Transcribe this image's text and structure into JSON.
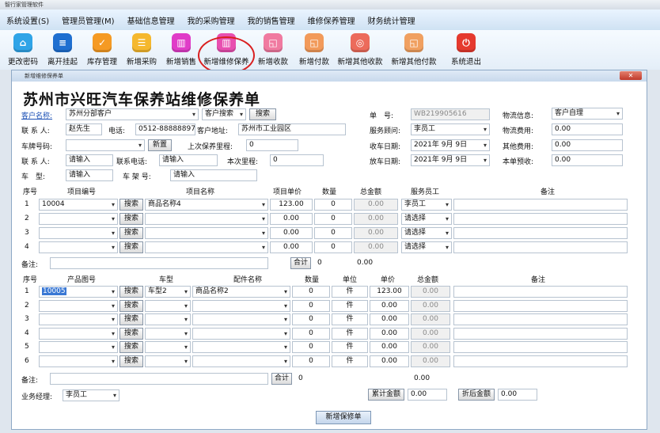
{
  "app": {
    "title": "智行家管理软件"
  },
  "menu": [
    "系统设置(S)",
    "管理员管理(M)",
    "基础信息管理",
    "我的采购管理",
    "我的销售管理",
    "维修保养管理",
    "财务统计管理"
  ],
  "toolbar": [
    {
      "label": "更改密码",
      "icon": "password-icon",
      "color": "#2fa4e7"
    },
    {
      "label": "离开挂起",
      "icon": "suspend-icon",
      "color": "#1f6fd0"
    },
    {
      "label": "库存管理",
      "icon": "inventory-icon",
      "color": "#f59a23"
    },
    {
      "label": "新增采购",
      "icon": "purchase-icon",
      "color": "#f5b82e"
    },
    {
      "label": "新增销售",
      "icon": "sales-chart-icon",
      "color": "#e03cc8"
    },
    {
      "label": "新增维修保养",
      "icon": "repair-chart-icon",
      "color": "#e84fb0"
    },
    {
      "label": "新增收款",
      "icon": "receive-icon",
      "color": "#f07aa0"
    },
    {
      "label": "新增付款",
      "icon": "payment-icon",
      "color": "#f29a5a"
    },
    {
      "label": "新增其他收款",
      "icon": "other-receive-icon",
      "color": "#ec6b5b"
    },
    {
      "label": "新增其他付款",
      "icon": "other-payment-icon",
      "color": "#f0a060"
    },
    {
      "label": "系统退出",
      "icon": "power-icon",
      "color": "#e53a2e"
    }
  ],
  "dialog": {
    "title": "新增维修保养单",
    "close": "✕",
    "heading": "苏州市兴旺汽车保养站维修保养单"
  },
  "header": {
    "customer_label": "客户名称:",
    "customer_value": "苏州分部客户",
    "search_mode": "客户搜索",
    "search_btn": "搜索",
    "order_label": "单　号:",
    "order_value": "WB219905616",
    "logistics_label": "物流信息:",
    "logistics_value": "客户自理",
    "contact_label": "联 系 人:",
    "contact_value": "赵先生",
    "phone_label": "电话:",
    "phone_value": "0512-88888897",
    "address_label": "客户地址:",
    "address_value": "苏州市工业园区",
    "advisor_label": "服务顾问:",
    "advisor_value": "李员工",
    "logistics_fee_label": "物流费用:",
    "logistics_fee_value": "0.00",
    "plate_label": "车牌号码:",
    "plate_value": "",
    "new_btn": "新置",
    "last_mileage_label": "上次保养里程:",
    "last_mileage_value": "0",
    "receive_date_label": "收车日期:",
    "receive_date_value": "2021年 9月 9日",
    "other_fee_label": "其他费用:",
    "other_fee_value": "0.00",
    "contact2_label": "联 系 人:",
    "contact2_value": "请输入",
    "contact_phone_label": "联系电话:",
    "contact_phone_value": "请输入",
    "mileage_label": "本次里程:",
    "mileage_value": "0",
    "release_date_label": "放车日期:",
    "release_date_value": "2021年 9月 9日",
    "prepay_label": "本单预收:",
    "prepay_value": "0.00",
    "car_type_label": "车　型:",
    "car_type_value": "请输入",
    "vin_label": "车 架 号:",
    "vin_value": "请输入"
  },
  "service_table": {
    "headers": [
      "序号",
      "项目编号",
      "项目名称",
      "项目单价",
      "数量",
      "总金额",
      "服务员工",
      "备注"
    ],
    "search_btn": "搜索",
    "rows": [
      {
        "no": "1",
        "code": "10004",
        "name": "商品名称4",
        "price": "123.00",
        "qty": "0",
        "total": "0.00",
        "staff": "李员工"
      },
      {
        "no": "2",
        "code": "",
        "name": "",
        "price": "0.00",
        "qty": "0",
        "total": "0.00",
        "staff": "请选择"
      },
      {
        "no": "3",
        "code": "",
        "name": "",
        "price": "0.00",
        "qty": "0",
        "total": "0.00",
        "staff": "请选择"
      },
      {
        "no": "4",
        "code": "",
        "name": "",
        "price": "0.00",
        "qty": "0",
        "total": "0.00",
        "staff": "请选择"
      }
    ],
    "remark_label": "备注:",
    "sum_btn": "合计",
    "sum_qty": "0",
    "sum_total": "0.00"
  },
  "parts_table": {
    "headers": [
      "序号",
      "产品图号",
      "车型",
      "配件名称",
      "数量",
      "单位",
      "单价",
      "总金额",
      "备注"
    ],
    "search_btn": "搜索",
    "rows": [
      {
        "no": "1",
        "code": "10005",
        "car": "车型2",
        "name": "商品名称2",
        "qty": "0",
        "unit": "件",
        "price": "123.00",
        "total": "0.00"
      },
      {
        "no": "2",
        "code": "",
        "car": "",
        "name": "",
        "qty": "0",
        "unit": "件",
        "price": "0.00",
        "total": "0.00"
      },
      {
        "no": "3",
        "code": "",
        "car": "",
        "name": "",
        "qty": "0",
        "unit": "件",
        "price": "0.00",
        "total": "0.00"
      },
      {
        "no": "4",
        "code": "",
        "car": "",
        "name": "",
        "qty": "0",
        "unit": "件",
        "price": "0.00",
        "total": "0.00"
      },
      {
        "no": "5",
        "code": "",
        "car": "",
        "name": "",
        "qty": "0",
        "unit": "件",
        "price": "0.00",
        "total": "0.00"
      },
      {
        "no": "6",
        "code": "",
        "car": "",
        "name": "",
        "qty": "0",
        "unit": "件",
        "price": "0.00",
        "total": "0.00"
      }
    ],
    "remark_label": "备注:",
    "sum_btn": "合计",
    "sum_qty": "0",
    "sum_total": "0.00"
  },
  "footer": {
    "manager_label": "业务经理:",
    "manager_value": "李员工",
    "cum_btn": "累计金额",
    "cum_value": "0.00",
    "disc_btn": "折后金额",
    "disc_value": "0.00",
    "submit": "新增保修单"
  }
}
